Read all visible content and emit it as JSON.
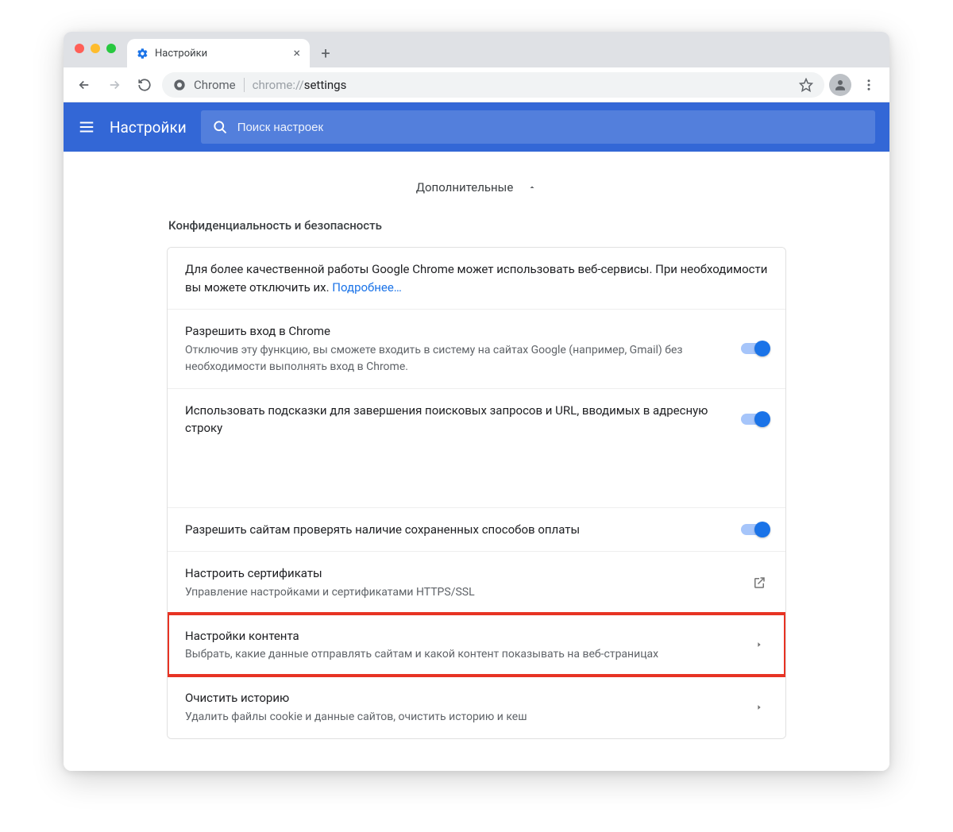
{
  "tab": {
    "title": "Настройки"
  },
  "omnibox": {
    "product": "Chrome",
    "url_prefix": "chrome://",
    "url_path": "settings"
  },
  "header": {
    "title": "Настройки",
    "search_placeholder": "Поиск настроек"
  },
  "advanced_label": "Дополнительные",
  "section": {
    "title": "Конфиденциальность и безопасность",
    "intro_text": "Для более качественной работы Google Chrome может использовать веб-сервисы. При необходимости вы можете отключить их. ",
    "intro_link": "Подробнее…",
    "rows": {
      "allow_signin": {
        "title": "Разрешить вход в Chrome",
        "sub": "Отключив эту функцию, вы сможете входить в систему на сайтах Google (например, Gmail) без необходимости выполнять вход в Chrome."
      },
      "autocomplete": {
        "title": "Использовать подсказки для завершения поисковых запросов и URL, вводимых в адресную строку"
      },
      "payment_check": {
        "title": "Разрешить сайтам проверять наличие сохраненных способов оплаты"
      },
      "certs": {
        "title": "Настроить сертификаты",
        "sub": "Управление настройками и сертификатами HTTPS/SSL"
      },
      "content_settings": {
        "title": "Настройки контента",
        "sub": "Выбрать, какие данные отправлять сайтам и какой контент показывать на веб-страницах"
      },
      "clear_history": {
        "title": "Очистить историю",
        "sub": "Удалить файлы cookie и данные сайтов, очистить историю и кеш"
      }
    }
  }
}
